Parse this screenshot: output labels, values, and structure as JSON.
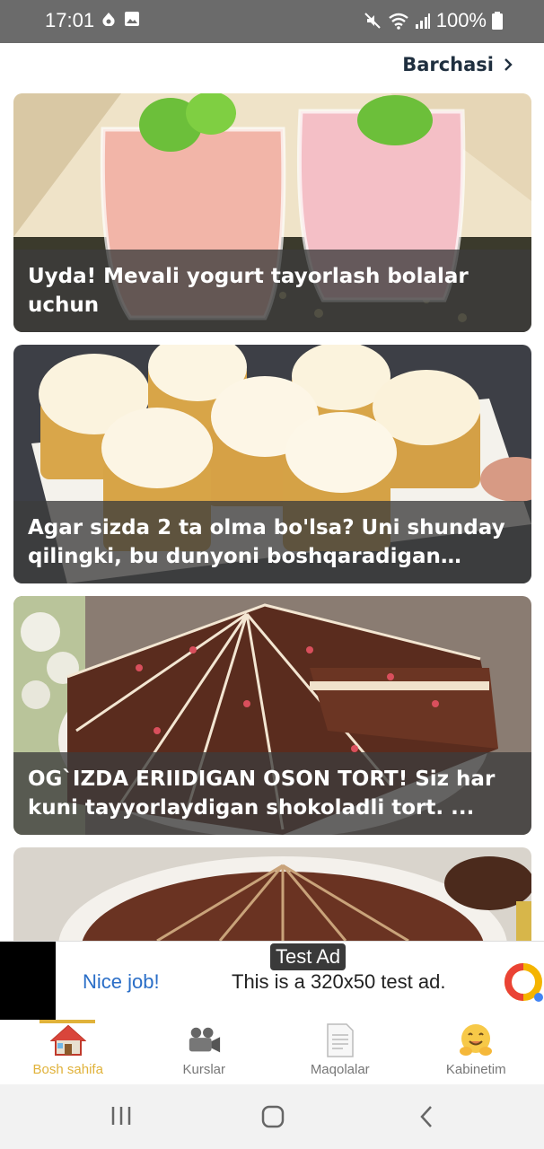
{
  "status_bar": {
    "time": "17:01",
    "battery": "100%"
  },
  "section": {
    "see_all_label": "Barchasi"
  },
  "cards": [
    {
      "title": "Uyda! Mevali yogurt tayorlash bolalar uchun"
    },
    {
      "title": "Agar sizda 2 ta olma bo'lsa? Uni shunday qilingki, bu dunyoni boshqaradigan mas..."
    },
    {
      "title": "OG`IZDA ERIIDIGAN OSON TORT! Siz har kuni tayyorlaydigan shokoladli tort. ..."
    },
    {
      "title": ""
    }
  ],
  "ad": {
    "tag": "Test Ad",
    "cta": "Nice job!",
    "text": "This is a 320x50 test ad."
  },
  "bottom_nav": {
    "items": [
      {
        "label": "Bosh sahifa",
        "icon": "house-icon",
        "active": true
      },
      {
        "label": "Kurslar",
        "icon": "movie-camera-icon",
        "active": false
      },
      {
        "label": "Maqolalar",
        "icon": "document-icon",
        "active": false
      },
      {
        "label": "Kabinetim",
        "icon": "hugging-face-icon",
        "active": false
      }
    ]
  },
  "colors": {
    "status_bar": "#6b6b6b",
    "accent": "#e0b23a",
    "ad_link": "#2a6ec7"
  }
}
